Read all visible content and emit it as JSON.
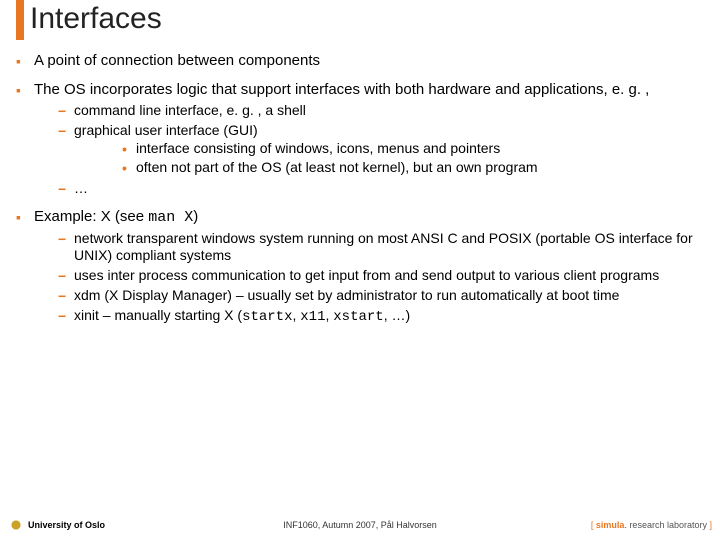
{
  "title": "Interfaces",
  "b1": "A point of connection between components",
  "b2": "The OS incorporates logic that support interfaces with both hardware and applications, e. g. ,",
  "b2s1": "command line interface, e. g. , a shell",
  "b2s2": "graphical user interface (GUI)",
  "b2s2a": "interface consisting of windows, icons, menus and pointers",
  "b2s2b": "often not part of the OS (at least not kernel), but an own program",
  "b2s3": "…",
  "b3_pre": "Example: X (see ",
  "b3_code": "man X",
  "b3_post": ")",
  "b3s1": "network transparent windows system running on most ANSI C and POSIX (portable OS interface for UNIX) compliant systems",
  "b3s2": "uses inter process communication to get input from and send output to various client programs",
  "b3s3": "xdm (X Display Manager) – usually set by administrator to run automatically at boot time",
  "b3s4_pre": "xinit – manually starting X (",
  "b3s4_c1": "startx",
  "b3s4_sep1": ", ",
  "b3s4_c2": "x11",
  "b3s4_sep2": ", ",
  "b3s4_c3": "xstart",
  "b3s4_post": ", …)",
  "footer": {
    "uio": "University of Oslo",
    "center": "INF1060, Autumn 2007, Pål Halvorsen",
    "sim": "simula",
    "lab": ". research laboratory"
  }
}
